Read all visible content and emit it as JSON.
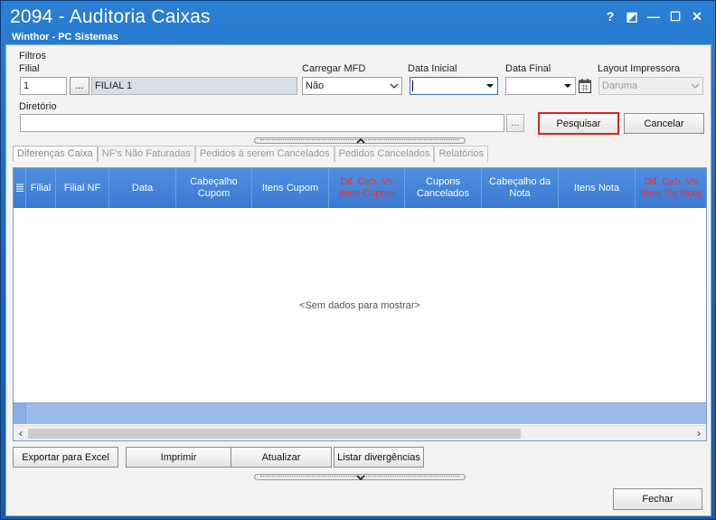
{
  "window": {
    "title": "2094 - Auditoria Caixas",
    "subtitle": "Winthor - PC Sistemas",
    "controls": {
      "help": "?",
      "restore": "◩",
      "minimize": "—",
      "maximize": "☐",
      "close": "✕"
    }
  },
  "filters": {
    "legend": "Filtros",
    "filial": {
      "label": "Filial",
      "value": "1",
      "lookup_label": "...",
      "description": "FILIAL 1"
    },
    "carregar_mfd": {
      "label": "Carregar MFD",
      "value": "Não"
    },
    "data_inicial": {
      "label": "Data Inicial",
      "value": ""
    },
    "data_final": {
      "label": "Data Final",
      "value": ""
    },
    "layout_impressora": {
      "label": "Layout Impressora",
      "value": "Daruma"
    },
    "diretorio": {
      "label": "Diretório",
      "value": "",
      "browse_label": "..."
    },
    "pesquisar_label": "Pesquisar",
    "cancelar_label": "Cancelar"
  },
  "tabs": [
    {
      "label": "Diferenças Caixa",
      "active": true
    },
    {
      "label": "NF's Não Faturadas",
      "active": false
    },
    {
      "label": "Pedidos à serem Cancelados",
      "active": false
    },
    {
      "label": "Pedidos Cancelados",
      "active": false
    },
    {
      "label": "Relatórios",
      "active": false
    }
  ],
  "grid": {
    "columns": [
      {
        "label": "Filial",
        "highlight": false
      },
      {
        "label": "Filial NF",
        "highlight": false
      },
      {
        "label": "Data",
        "highlight": false
      },
      {
        "label": "Cabeçalho Cupom",
        "highlight": false
      },
      {
        "label": "Itens Cupom",
        "highlight": false
      },
      {
        "label": "Dif. Cab. Vs Itens Cupom",
        "highlight": true
      },
      {
        "label": "Cupons Cancelados",
        "highlight": false
      },
      {
        "label": "Cabeçalho da Nota",
        "highlight": false
      },
      {
        "label": "Itens Nota",
        "highlight": false
      },
      {
        "label": "Dif. Cab. Vs Itens Da Nota",
        "highlight": true
      }
    ],
    "empty_text": "<Sem dados para mostrar>",
    "highlight_color": "#ff2a2a"
  },
  "actions": {
    "exportar": "Exportar para Excel",
    "imprimir": "Imprimir",
    "atualizar": "Atualizar",
    "listar": "Listar divergências",
    "fechar": "Fechar"
  }
}
